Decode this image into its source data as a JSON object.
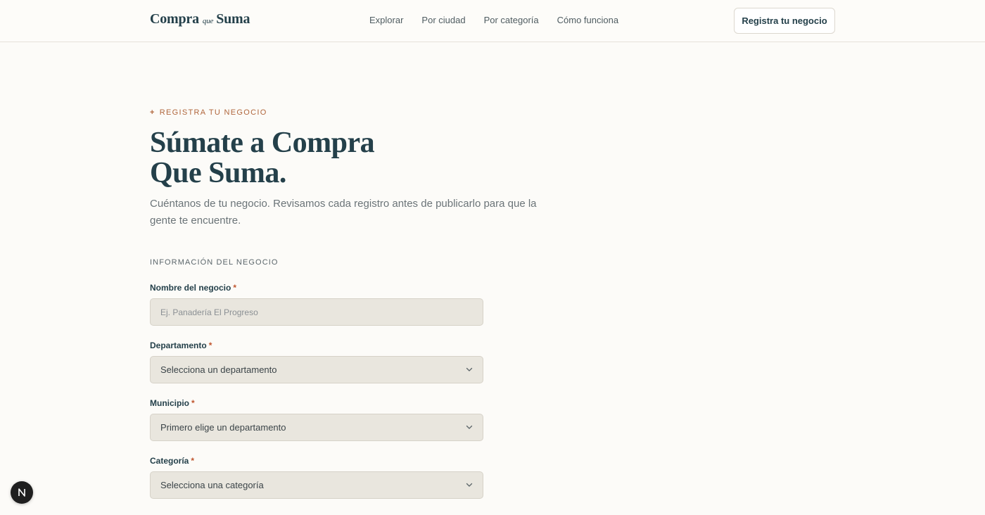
{
  "header": {
    "logo": {
      "part1": "Compra",
      "part2": "que",
      "part3": "Suma"
    },
    "nav": [
      "Explorar",
      "Por ciudad",
      "Por categoría",
      "Cómo funciona"
    ],
    "cta_label": "Registra tu negocio"
  },
  "hero": {
    "eyebrow_icon": "+",
    "eyebrow": "REGISTRA TU NEGOCIO",
    "title_line1": "Súmate a Compra",
    "title_line2": "Que Suma.",
    "description": "Cuéntanos de tu negocio. Revisamos cada registro antes de publicarlo para que la gente te encuentre."
  },
  "form": {
    "section_title": "INFORMACIÓN DEL NEGOCIO",
    "required_mark": "*",
    "fields": {
      "name": {
        "label": "Nombre del negocio",
        "placeholder": "Ej. Panadería El Progreso",
        "value": ""
      },
      "department": {
        "label": "Departamento",
        "selected": "Selecciona un departamento"
      },
      "municipality": {
        "label": "Municipio",
        "selected": "Primero elige un departamento"
      },
      "category": {
        "label": "Categoría",
        "selected": "Selecciona una categoría"
      }
    }
  },
  "fab": {
    "icon": "next-logo-icon",
    "label": "N"
  },
  "colors": {
    "accent": "#b0663c",
    "primary_text": "#24404a",
    "required": "#c0562f",
    "field_bg": "#e9e6de",
    "page_bg": "#fcfbf8"
  }
}
